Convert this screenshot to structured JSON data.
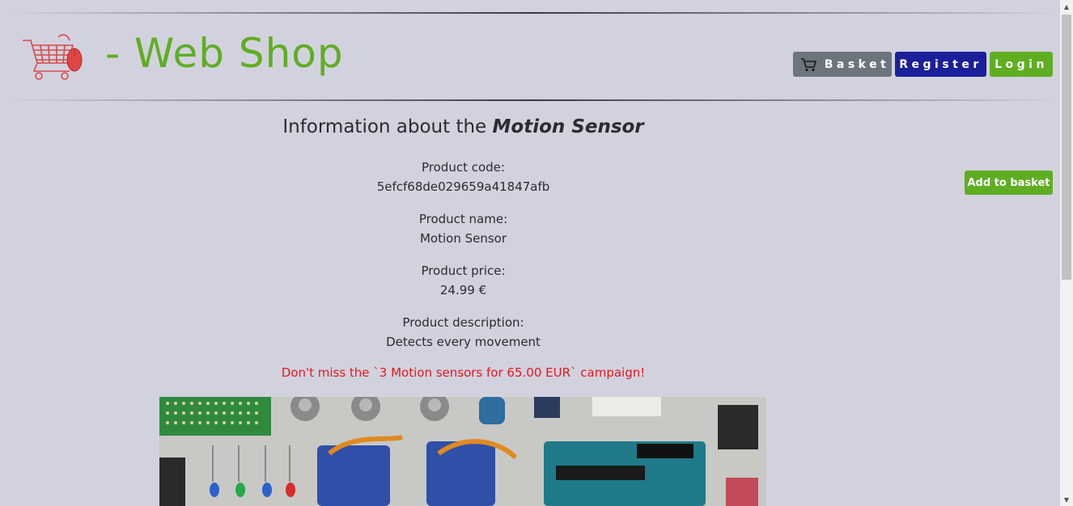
{
  "header": {
    "title": "- Web Shop",
    "basket_label": "Basket",
    "register_label": "Register",
    "login_label": "Login"
  },
  "product": {
    "heading_prefix": "Information about the",
    "heading_name": "Motion Sensor",
    "code_label": "Product code:",
    "code_value": "5efcf68de029659a41847afb",
    "name_label": "Product name:",
    "name_value": "Motion Sensor",
    "price_label": "Product price:",
    "price_value": "24.99 €",
    "description_label": "Product description:",
    "description_value": "Detects every movement",
    "campaign_text": "Don't miss the `3 Motion sensors for 65.00 EUR` campaign!",
    "add_to_basket_label": "Add to basket"
  },
  "colors": {
    "background": "#d2d2df",
    "brand_green": "#5fae22",
    "register_blue": "#1b1f9a",
    "basket_gray": "#6c757d",
    "campaign_red": "#e8161c"
  },
  "icons": {
    "logo": "shopping-cart-with-mouse-logo",
    "basket": "cart-icon",
    "scroll_up": "chevron-up-icon",
    "scroll_down": "chevron-down-icon"
  }
}
